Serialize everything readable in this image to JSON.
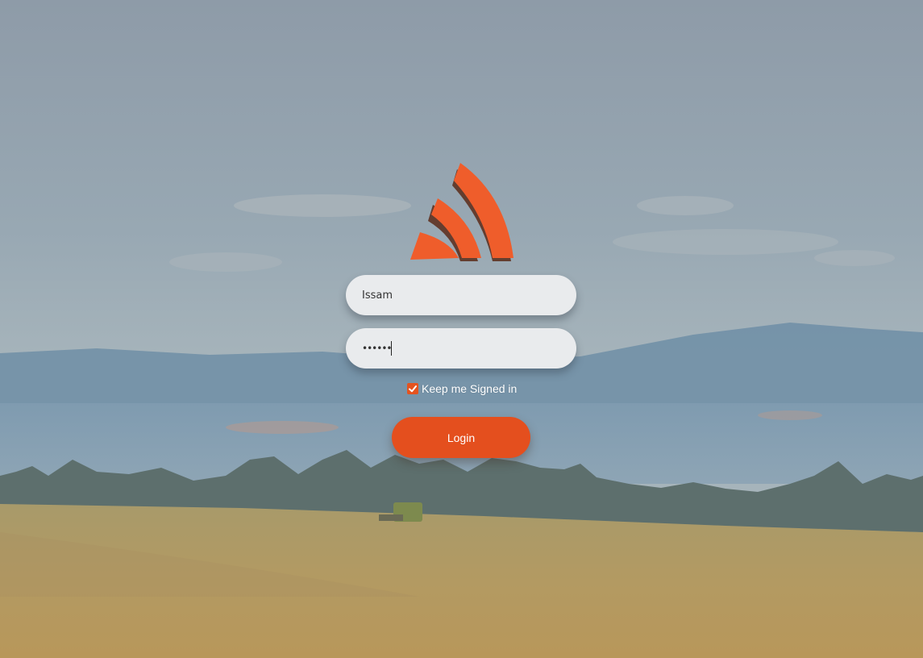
{
  "login": {
    "username_value": "Issam",
    "password_masked": "••••••",
    "remember_label": "Keep me Signed in",
    "remember_checked": true,
    "login_label": "Login"
  },
  "icons": {
    "logo": "orange-w-logo-icon",
    "checkbox": "check-icon"
  },
  "colors": {
    "accent": "#e4531f",
    "field_bg": "#e9ebed"
  }
}
